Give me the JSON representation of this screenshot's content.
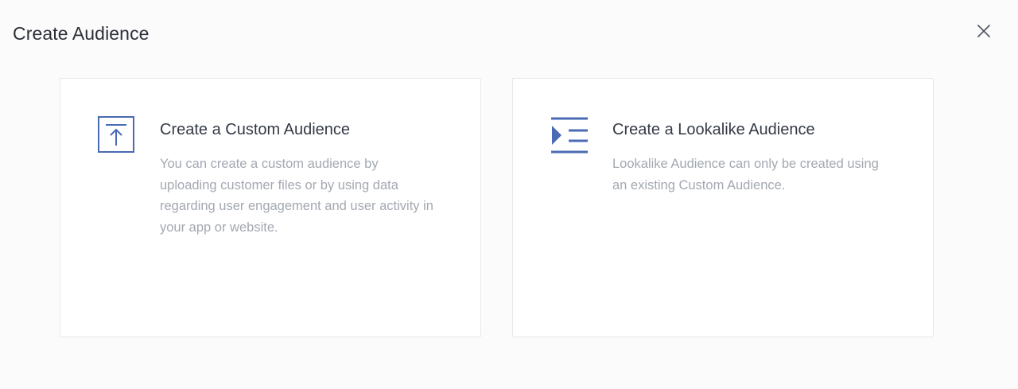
{
  "dialog": {
    "title": "Create Audience",
    "close_icon": "close-icon"
  },
  "options": [
    {
      "title": "Create a Custom Audience",
      "description": "You can create a custom audience by uploading customer files or by using data regarding user engagement and user activity in your app or website.",
      "icon": "upload-icon"
    },
    {
      "title": "Create a Lookalike Audience",
      "description": "Lookalike Audience can only be created using an existing Custom Audience.",
      "icon": "list-indent-icon"
    }
  ],
  "colors": {
    "accent": "#4a6bb3",
    "title_text": "#2b2f36",
    "description_text": "#a3a8b1"
  }
}
